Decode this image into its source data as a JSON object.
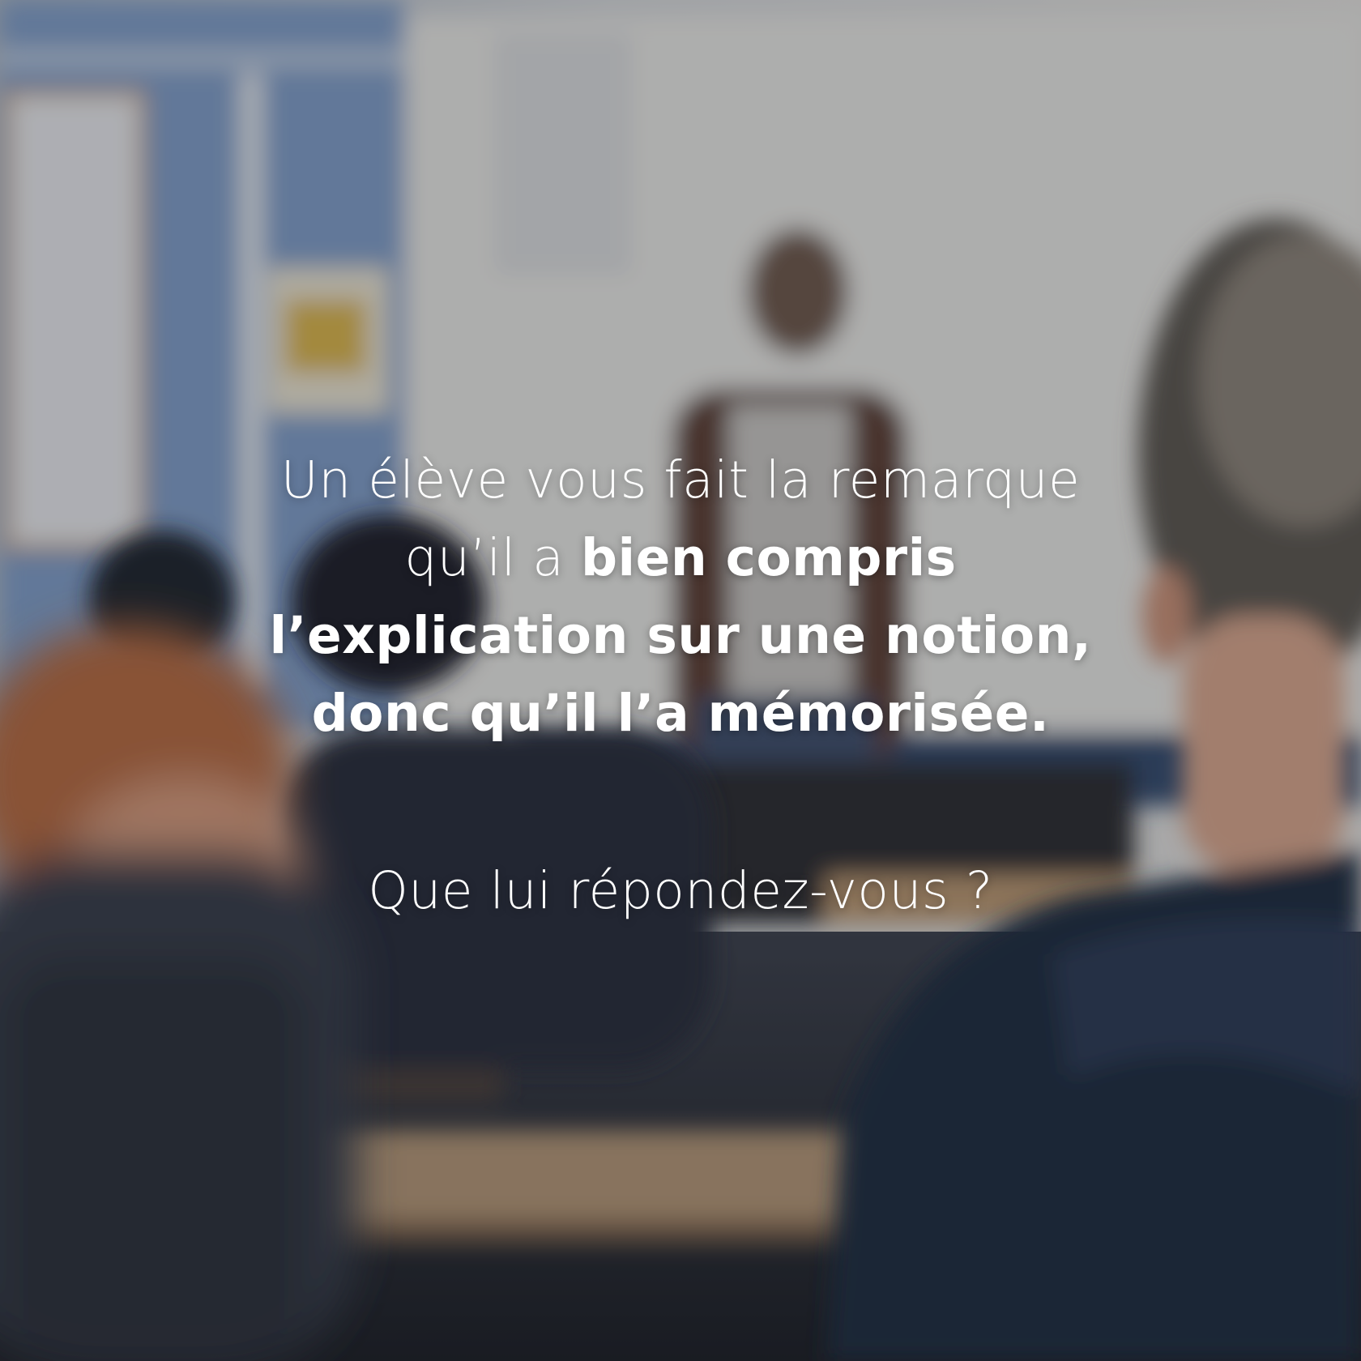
{
  "prompt": {
    "line1": "Un élève vous fait la remarque",
    "line2_regular": "qu’il a ",
    "line2_bold": "bien compris",
    "line3_bold": "l’explication sur une notion,",
    "line4_bold": "donc qu’il l’a mémorisée.",
    "question": "Que lui répondez-vous ?"
  },
  "colors": {
    "text": "#ffffff",
    "wall": "#c9cdd2",
    "blue_wall": "#7b9ac6",
    "hoodie": "#1f2a3d",
    "hair_red": "#b1643a"
  }
}
